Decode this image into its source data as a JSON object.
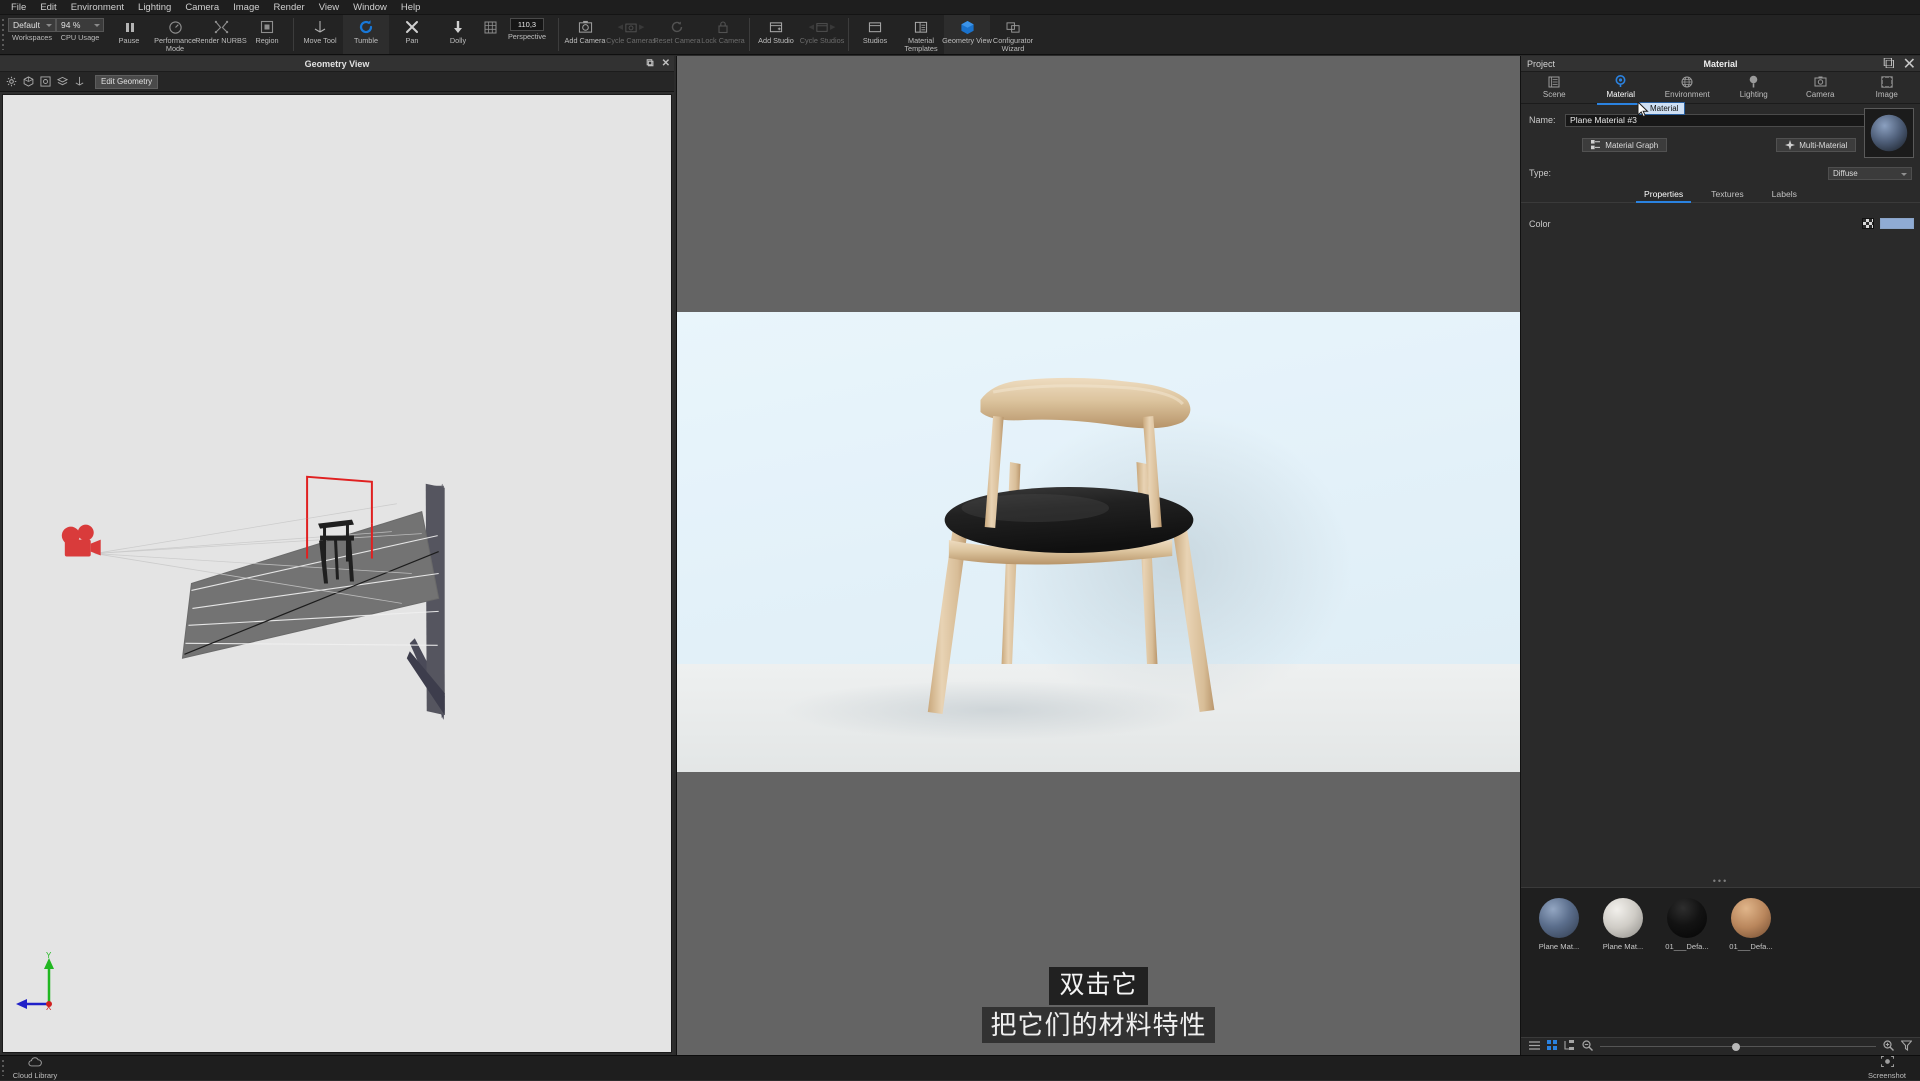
{
  "menubar": {
    "items": [
      "File",
      "Edit",
      "Environment",
      "Lighting",
      "Camera",
      "Image",
      "Render",
      "View",
      "Window",
      "Help"
    ]
  },
  "toolbar": {
    "workspaces": {
      "value": "Default",
      "label": "Workspaces"
    },
    "cpu_usage": {
      "value": "94 %",
      "label": "CPU Usage"
    },
    "buttons": [
      {
        "label": "Pause",
        "icon": "pause-icon",
        "state": "normal"
      },
      {
        "label": "Performance Mode",
        "icon": "performance-icon",
        "state": "normal"
      },
      {
        "label": "Render NURBS",
        "icon": "nurbs-icon",
        "state": "normal"
      },
      {
        "label": "Region",
        "icon": "region-icon",
        "state": "normal"
      },
      {
        "label": "Move Tool",
        "icon": "move-tool-icon",
        "state": "normal"
      },
      {
        "label": "Tumble",
        "icon": "tumble-icon",
        "state": "active"
      },
      {
        "label": "Pan",
        "icon": "pan-icon",
        "state": "normal"
      },
      {
        "label": "Dolly",
        "icon": "dolly-icon",
        "state": "normal"
      }
    ],
    "perspective": {
      "value": "110,3",
      "label": "Perspective",
      "icon": "grid-icon"
    },
    "camera_group": [
      {
        "label": "Add Camera",
        "icon": "add-camera-icon",
        "state": "normal"
      },
      {
        "label": "Cycle Cameras",
        "icon": "cycle-cameras-icon",
        "state": "disabled"
      },
      {
        "label": "Reset Camera",
        "icon": "reset-camera-icon",
        "state": "disabled"
      },
      {
        "label": "Lock Camera",
        "icon": "lock-camera-icon",
        "state": "disabled"
      }
    ],
    "studio_group": [
      {
        "label": "Add Studio",
        "icon": "add-studio-icon",
        "state": "normal"
      },
      {
        "label": "Cycle Studios",
        "icon": "cycle-studios-icon",
        "state": "disabled"
      }
    ],
    "right_group": [
      {
        "label": "Studios",
        "icon": "studios-icon",
        "state": "normal"
      },
      {
        "label": "Material Templates",
        "icon": "material-templates-icon",
        "state": "normal"
      },
      {
        "label": "Geometry View",
        "icon": "geometry-view-icon",
        "state": "active"
      },
      {
        "label": "Configurator Wizard",
        "icon": "configurator-wizard-icon",
        "state": "normal"
      }
    ]
  },
  "geometry_view": {
    "title": "Geometry View",
    "toolbar_icons": [
      "gear-icon",
      "cube-icon",
      "camera-frame-icon",
      "layers-icon",
      "move-tool-icon"
    ],
    "edit_button": "Edit Geometry",
    "window_buttons": [
      "restore-icon",
      "close-icon"
    ],
    "axis_labels": {
      "y": "Y",
      "x": "X"
    },
    "background": "#e4e4e4"
  },
  "render_view": {
    "background": "#646464",
    "image_bg": "#e8f4fa",
    "floor": "#f0f0f0"
  },
  "subtitles": {
    "line1": "双击它",
    "line2": "把它们的材料特性"
  },
  "project_panel": {
    "label": "Project",
    "title": "Material",
    "window_buttons": [
      "restore-icon",
      "close-icon"
    ],
    "tabs": [
      {
        "label": "Scene",
        "icon": "scene-list-icon",
        "selected": false
      },
      {
        "label": "Material",
        "icon": "material-sphere-icon",
        "selected": true
      },
      {
        "label": "Environment",
        "icon": "globe-icon",
        "selected": false
      },
      {
        "label": "Lighting",
        "icon": "light-bulb-icon",
        "selected": false
      },
      {
        "label": "Camera",
        "icon": "camera-icon",
        "selected": false
      },
      {
        "label": "Image",
        "icon": "image-frame-icon",
        "selected": false
      }
    ],
    "name_label": "Name:",
    "name_value": "Plane Material #3",
    "tooltip": "Material",
    "material_graph_button": "Material Graph",
    "multi_material_button": "Multi-Material",
    "type_label": "Type:",
    "type_value": "Diffuse",
    "sub_tabs": [
      {
        "label": "Properties",
        "selected": true
      },
      {
        "label": "Textures",
        "selected": false
      },
      {
        "label": "Labels",
        "selected": false
      }
    ],
    "color_label": "Color",
    "color_value": "#8fabd4",
    "accent_color": "#2a82e0"
  },
  "material_library": {
    "items": [
      {
        "name": "Plane Mat...",
        "color": "#6b7f9e"
      },
      {
        "name": "Plane Mat...",
        "color": "#c9c6c0"
      },
      {
        "name": "01___Defa...",
        "color": "#161616"
      },
      {
        "name": "01___Defa...",
        "color": "#b9855e"
      }
    ],
    "toolbar_icons": [
      "list-view-icon",
      "grid-view-icon",
      "tree-view-icon",
      "zoom-out-icon",
      "zoom-in-icon",
      "filter-icon"
    ]
  },
  "statusbar": {
    "left": {
      "label": "Cloud Library",
      "icon": "cloud-icon"
    },
    "right": {
      "label": "Screenshot",
      "icon": "screenshot-icon"
    }
  }
}
